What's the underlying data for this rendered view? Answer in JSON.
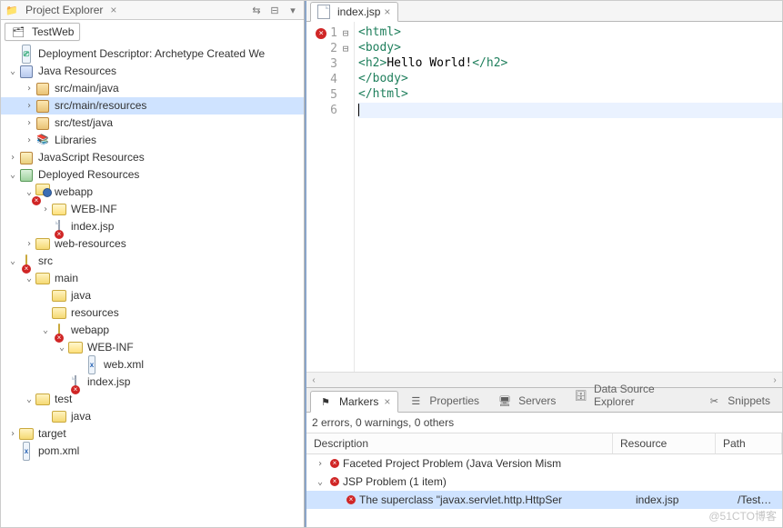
{
  "explorer": {
    "title": "Project Explorer",
    "close_icon": "×",
    "project_tab": "TestWeb",
    "tree": [
      {
        "d": 0,
        "ex": null,
        "icon": "dd",
        "label": "Deployment Descriptor: Archetype Created We"
      },
      {
        "d": 0,
        "ex": "open",
        "icon": "jres",
        "label": "Java Resources"
      },
      {
        "d": 1,
        "ex": "closed",
        "icon": "pkg",
        "label": "src/main/java"
      },
      {
        "d": 1,
        "ex": "closed",
        "icon": "pkg",
        "label": "src/main/resources",
        "sel": true
      },
      {
        "d": 1,
        "ex": "closed",
        "icon": "pkg",
        "label": "src/test/java"
      },
      {
        "d": 1,
        "ex": "closed",
        "icon": "lib",
        "label": "Libraries"
      },
      {
        "d": 0,
        "ex": "closed",
        "icon": "js",
        "label": "JavaScript Resources"
      },
      {
        "d": 0,
        "ex": "open",
        "icon": "dep",
        "label": "Deployed Resources"
      },
      {
        "d": 1,
        "ex": "open",
        "icon": "webapp-err",
        "label": "webapp"
      },
      {
        "d": 2,
        "ex": "closed",
        "icon": "fld-open",
        "label": "WEB-INF"
      },
      {
        "d": 2,
        "ex": null,
        "icon": "jsp-err",
        "label": "index.jsp"
      },
      {
        "d": 1,
        "ex": "closed",
        "icon": "fld",
        "label": "web-resources"
      },
      {
        "d": 0,
        "ex": "open",
        "icon": "fld-err",
        "label": "src"
      },
      {
        "d": 1,
        "ex": "open",
        "icon": "fld",
        "label": "main"
      },
      {
        "d": 2,
        "ex": null,
        "icon": "fld",
        "label": "java"
      },
      {
        "d": 2,
        "ex": null,
        "icon": "fld",
        "label": "resources"
      },
      {
        "d": 2,
        "ex": "open",
        "icon": "fld-err",
        "label": "webapp"
      },
      {
        "d": 3,
        "ex": "open",
        "icon": "fld-open",
        "label": "WEB-INF"
      },
      {
        "d": 4,
        "ex": null,
        "icon": "xml",
        "label": "web.xml"
      },
      {
        "d": 3,
        "ex": null,
        "icon": "jsp-err",
        "label": "index.jsp"
      },
      {
        "d": 1,
        "ex": "open",
        "icon": "fld",
        "label": "test"
      },
      {
        "d": 2,
        "ex": null,
        "icon": "fld",
        "label": "java"
      },
      {
        "d": 0,
        "ex": "closed",
        "icon": "fld",
        "label": "target"
      },
      {
        "d": 0,
        "ex": null,
        "icon": "xml",
        "label": "pom.xml"
      }
    ]
  },
  "editor": {
    "tab_label": "index.jsp",
    "lines": [
      {
        "n": 1,
        "err": true,
        "fold": true,
        "seg": [
          {
            "t": "<",
            "c": "tag"
          },
          {
            "t": "html",
            "c": "tag"
          },
          {
            "t": ">",
            "c": "tag"
          }
        ]
      },
      {
        "n": 2,
        "fold": true,
        "seg": [
          {
            "t": "<",
            "c": "tag"
          },
          {
            "t": "body",
            "c": "tag"
          },
          {
            "t": ">",
            "c": "tag"
          }
        ]
      },
      {
        "n": 3,
        "seg": [
          {
            "t": "<",
            "c": "tag"
          },
          {
            "t": "h2",
            "c": "tag"
          },
          {
            "t": ">",
            "c": "tag"
          },
          {
            "t": "Hello World!",
            "c": "txt"
          },
          {
            "t": "</",
            "c": "tag"
          },
          {
            "t": "h2",
            "c": "tag"
          },
          {
            "t": ">",
            "c": "tag"
          }
        ]
      },
      {
        "n": 4,
        "seg": [
          {
            "t": "</",
            "c": "tag"
          },
          {
            "t": "body",
            "c": "tag"
          },
          {
            "t": ">",
            "c": "tag"
          }
        ]
      },
      {
        "n": 5,
        "seg": [
          {
            "t": "</",
            "c": "tag"
          },
          {
            "t": "html",
            "c": "tag"
          },
          {
            "t": ">",
            "c": "tag"
          }
        ]
      },
      {
        "n": 6,
        "caret": true,
        "seg": []
      }
    ]
  },
  "panel": {
    "tabs": [
      {
        "label": "Markers",
        "icon": "markers",
        "active": true,
        "closable": true
      },
      {
        "label": "Properties",
        "icon": "props"
      },
      {
        "label": "Servers",
        "icon": "servers"
      },
      {
        "label": "Data Source Explorer",
        "icon": "dse"
      },
      {
        "label": "Snippets",
        "icon": "snip"
      }
    ],
    "summary": "2 errors, 0 warnings, 0 others",
    "columns": {
      "desc": "Description",
      "res": "Resource",
      "path": "Path"
    },
    "rows": [
      {
        "ex": "closed",
        "icon": "err",
        "desc": "Faceted Project Problem (Java Version Mism",
        "res": "",
        "path": ""
      },
      {
        "ex": "open",
        "icon": "err",
        "desc": "JSP Problem (1 item)",
        "res": "",
        "path": ""
      },
      {
        "ex": null,
        "icon": "err",
        "desc": "The superclass \"javax.servlet.http.HttpSer",
        "res": "index.jsp",
        "path": "/TestWeb/src/main/we",
        "sel": true,
        "indent": 1
      }
    ]
  },
  "watermark": "@51CTO博客"
}
